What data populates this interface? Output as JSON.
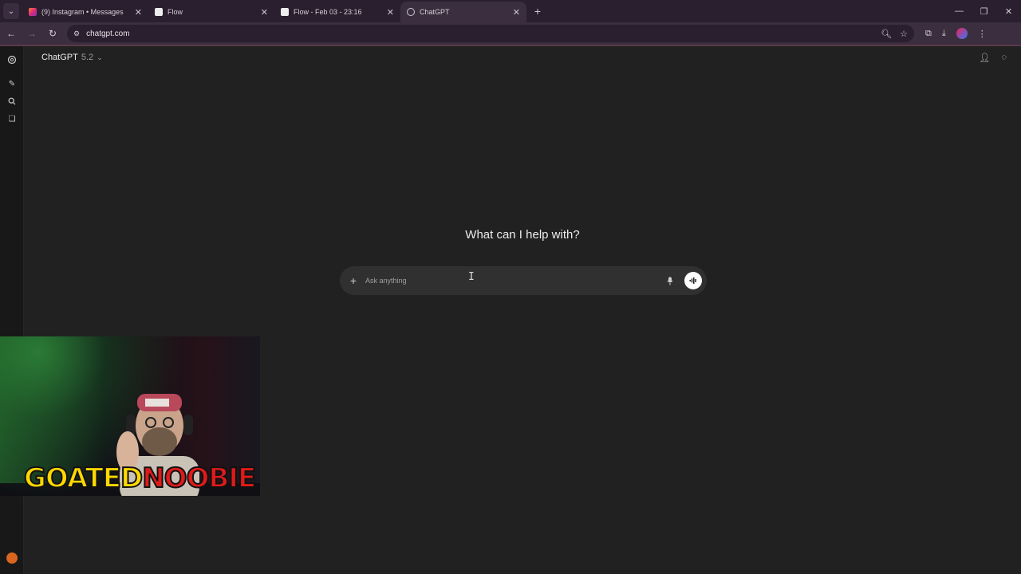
{
  "browser": {
    "tabs": [
      {
        "title": "(9) Instagram • Messages",
        "icon": "instagram-icon",
        "active": false
      },
      {
        "title": "Flow",
        "icon": "page-icon",
        "active": false
      },
      {
        "title": "Flow - Feb 03 - 23:16",
        "icon": "page-icon",
        "active": false
      },
      {
        "title": "ChatGPT",
        "icon": "chatgpt-icon",
        "active": true
      }
    ],
    "url": "chatgpt.com"
  },
  "app": {
    "model_name": "ChatGPT",
    "model_version": "5.2",
    "greeting": "What can I help with?",
    "composer_placeholder": "Ask anything"
  },
  "overlay": {
    "logo_part1": "GOATED",
    "logo_part2": "NOOBIE"
  },
  "colors": {
    "background": "#212121",
    "sidebar": "#181818",
    "composer": "#303030",
    "browser_frame": "#3b2f3f",
    "logo_yellow": "#ffd800",
    "logo_red": "#e01a1a"
  }
}
